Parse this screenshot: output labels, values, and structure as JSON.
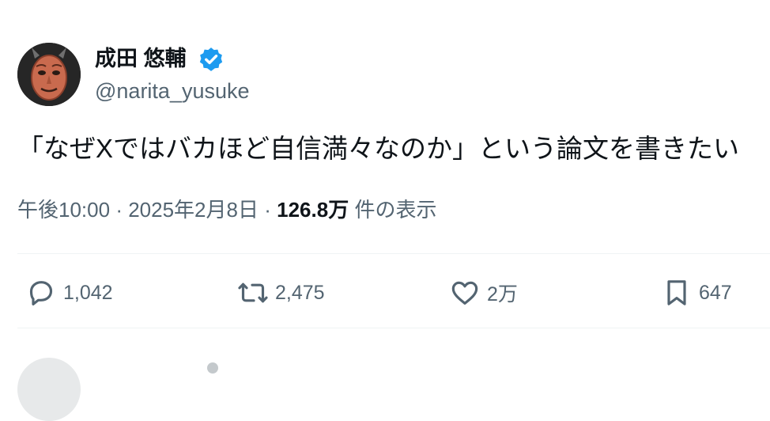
{
  "tweet": {
    "author": {
      "name": "成田 悠輔",
      "handle": "@narita_yusuke",
      "verified": true,
      "avatar_icon": "red-mask-avatar-icon"
    },
    "text": "「なぜXではバカほど自信満々なのか」という論文を書きたい",
    "meta": {
      "time": "午後10:00",
      "separator": "·",
      "date": "2025年2月8日",
      "views": "126.8万",
      "views_suffix": "件の表示"
    },
    "actions": {
      "reply": {
        "icon": "reply-icon",
        "count": "1,042"
      },
      "retweet": {
        "icon": "retweet-icon",
        "count": "2,475"
      },
      "like": {
        "icon": "heart-icon",
        "count": "2万"
      },
      "bookmark": {
        "icon": "bookmark-icon",
        "count": "647"
      }
    }
  },
  "colors": {
    "text_primary": "#0f1419",
    "text_secondary": "#536471",
    "verified_blue": "#1d9bf0",
    "divider": "#eff3f4"
  }
}
